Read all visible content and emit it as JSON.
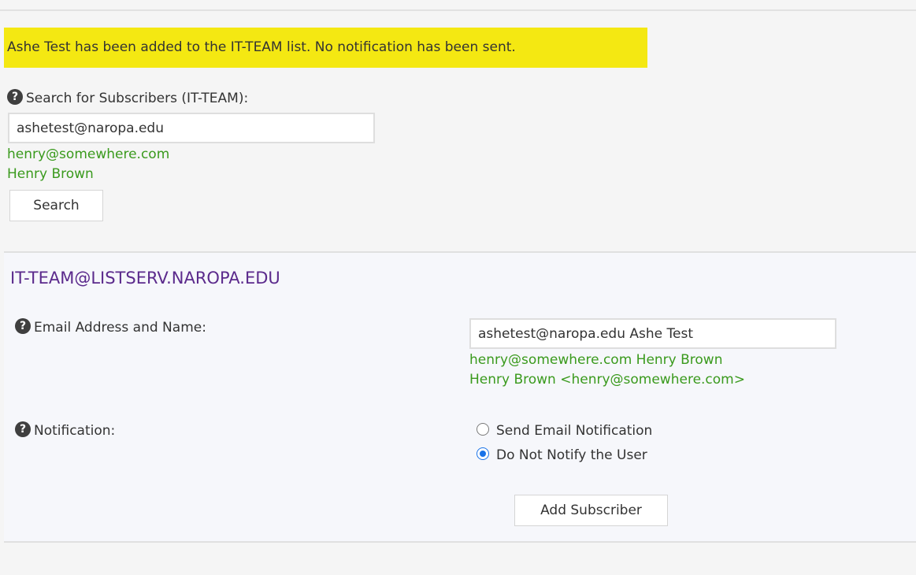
{
  "notice": {
    "text": "Ashe Test has been added to the IT-TEAM list. No notification has been sent."
  },
  "search": {
    "label": "Search for Subscribers (IT-TEAM):",
    "value": "ashetest@naropa.edu",
    "hints": [
      "henry@somewhere.com",
      "Henry Brown"
    ],
    "button_label": "Search"
  },
  "list_form": {
    "title": "IT-TEAM@LISTSERV.NAROPA.EDU",
    "email_label": "Email Address and Name:",
    "email_value": "ashetest@naropa.edu Ashe Test",
    "email_hints": [
      "henry@somewhere.com Henry Brown",
      "Henry Brown <henry@somewhere.com>"
    ],
    "notification_label": "Notification:",
    "notification_options": [
      {
        "label": "Send Email Notification",
        "selected": false
      },
      {
        "label": "Do Not Notify the User",
        "selected": true
      }
    ],
    "submit_label": "Add Subscriber"
  },
  "colors": {
    "notice_bg": "#f4e812",
    "hint_green": "#3a9a1d",
    "title_purple": "#5b2a8c",
    "panel_bg": "#f6f7fb",
    "page_bg": "#f5f5f5"
  },
  "icons": {
    "help": "?"
  }
}
